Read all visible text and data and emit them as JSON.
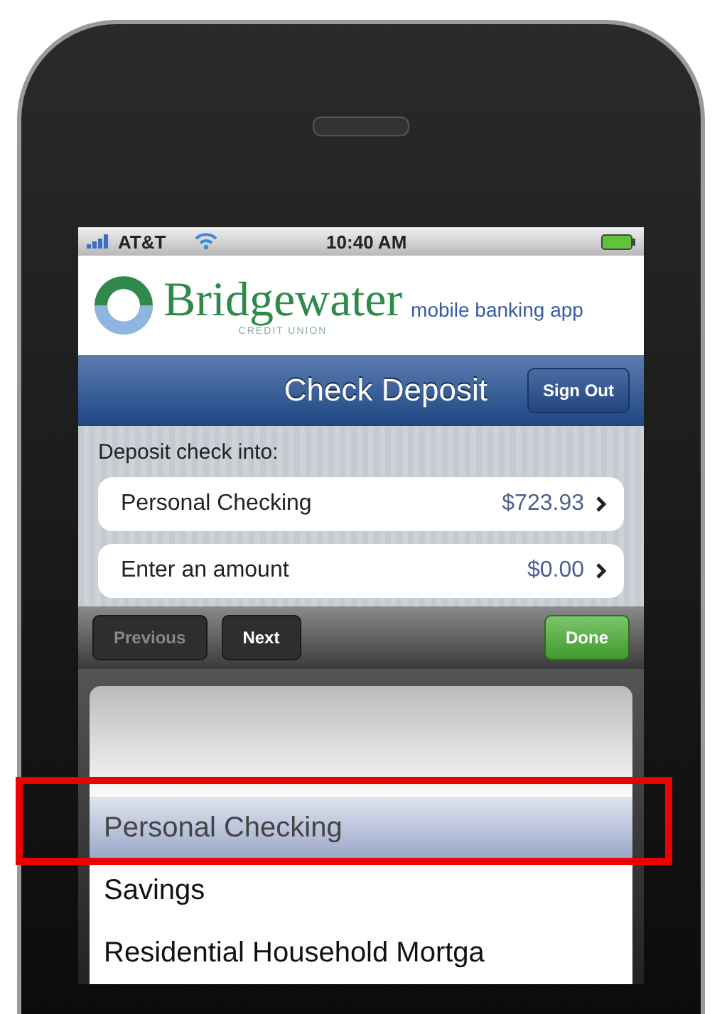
{
  "status_bar": {
    "carrier": "AT&T",
    "time": "10:40 AM"
  },
  "header": {
    "brand": "Bridgewater",
    "brand_sub": "CREDIT UNION",
    "tagline": "mobile banking app"
  },
  "nav_bar": {
    "title": "Check Deposit",
    "button": "Sign Out"
  },
  "form": {
    "label": "Deposit check into:",
    "rows": [
      {
        "label": "Personal Checking",
        "value": "$723.93"
      },
      {
        "label": "Enter an amount",
        "value": "$0.00"
      }
    ]
  },
  "toolbar": {
    "buttons": [
      {
        "label": "Previous",
        "disabled": true
      },
      {
        "label": "Next",
        "disabled": false
      }
    ],
    "done": "Done"
  },
  "picker": {
    "items": [
      {
        "label": "Personal Checking",
        "selected": true
      },
      {
        "label": "Savings",
        "selected": false
      },
      {
        "label": "Residential Household Mortga",
        "selected": false
      }
    ]
  }
}
